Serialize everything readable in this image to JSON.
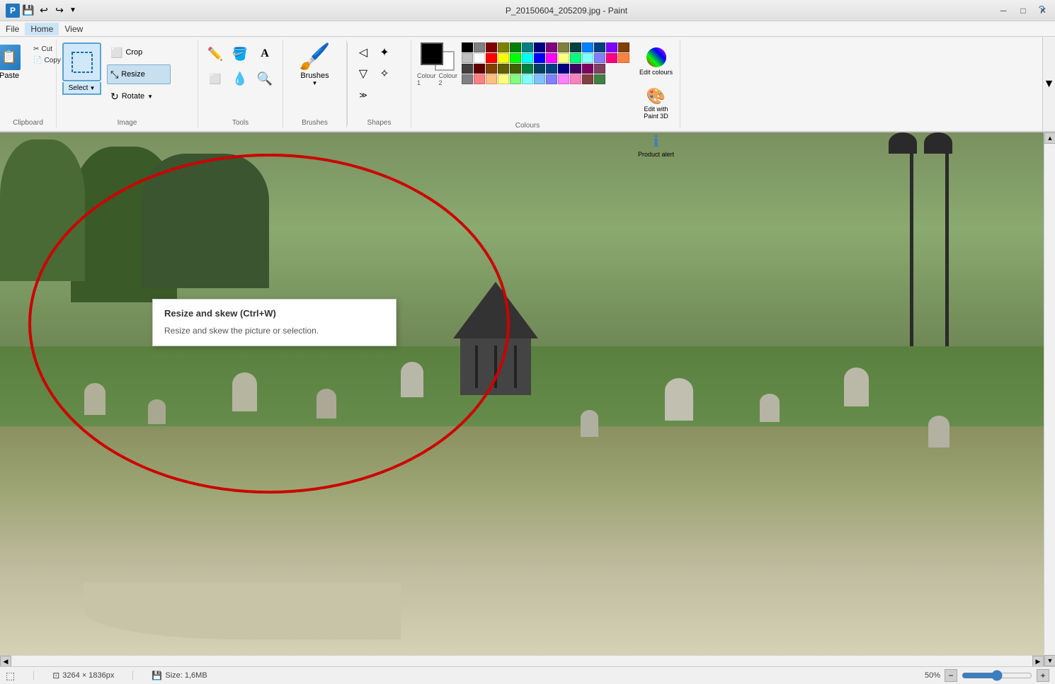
{
  "window": {
    "title": "P_20150604_205209.jpg - Paint",
    "titlebar_bg": "#e8e8e8"
  },
  "titlebar": {
    "quick_access": [
      "undo",
      "redo",
      "save"
    ],
    "controls": [
      "minimize",
      "maximize",
      "close"
    ]
  },
  "menubar": {
    "items": [
      "File",
      "Home",
      "View"
    ]
  },
  "ribbon": {
    "clipboard": {
      "label": "Clipboard",
      "paste_label": "Paste",
      "cut_label": "Cut",
      "copy_label": "Copy"
    },
    "image": {
      "label": "Image",
      "select_label": "Select",
      "crop_label": "Crop",
      "resize_label": "Resize",
      "rotate_label": "Rotate"
    },
    "tools": {
      "label": "Tools",
      "pencil": "✏",
      "fill": "🪣",
      "text": "A",
      "eraser": "⬜",
      "picker": "💧",
      "magnifier": "🔍"
    },
    "brushes": {
      "label": "Brushes",
      "icon": "🖌"
    },
    "shapes": {
      "label": "Shapes"
    },
    "colors": {
      "label": "Colours",
      "color1_label": "Colour 1",
      "color2_label": "Colour 2",
      "edit_colors_label": "Edit colours",
      "edit_paint3d_label": "Edit with Paint 3D",
      "product_alert_label": "Product alert",
      "palette": [
        [
          "#000000",
          "#808080",
          "#800000",
          "#808000",
          "#008000",
          "#008080",
          "#000080",
          "#800080",
          "#808040",
          "#004040",
          "#0080ff",
          "#004080",
          "#8000ff",
          "#804000",
          "#ffffff"
        ],
        [
          "#c0c0c0",
          "#ffffff",
          "#ff0000",
          "#ffff00",
          "#00ff00",
          "#00ffff",
          "#0000ff",
          "#ff00ff",
          "#ffff80",
          "#00ff80",
          "#80ffff",
          "#8080ff",
          "#ff0080",
          "#ff8040",
          "#ffffff"
        ],
        [
          "#000000",
          "#404040",
          "#800000",
          "#804000",
          "#808000",
          "#408000",
          "#008000",
          "#008040",
          "#008080",
          "#004080",
          "#0000ff",
          "#000080",
          "#800080",
          "#804080",
          "#c0c0c0"
        ],
        [
          "#808080",
          "#c0c0c0",
          "#ff8080",
          "#ffc080",
          "#ffff80",
          "#80ff80",
          "#80ffff",
          "#80c0ff",
          "#8080ff",
          "#ff80ff",
          "#ff80c0",
          "#804040",
          "#808040",
          "#408040",
          "#408080"
        ]
      ]
    }
  },
  "tooltip": {
    "title": "Resize and skew (Ctrl+W)",
    "description": "Resize and skew the picture or selection."
  },
  "statusbar": {
    "dimensions": "3264 × 1836px",
    "file_size": "Size: 1,6MB",
    "zoom_level": "50%"
  }
}
